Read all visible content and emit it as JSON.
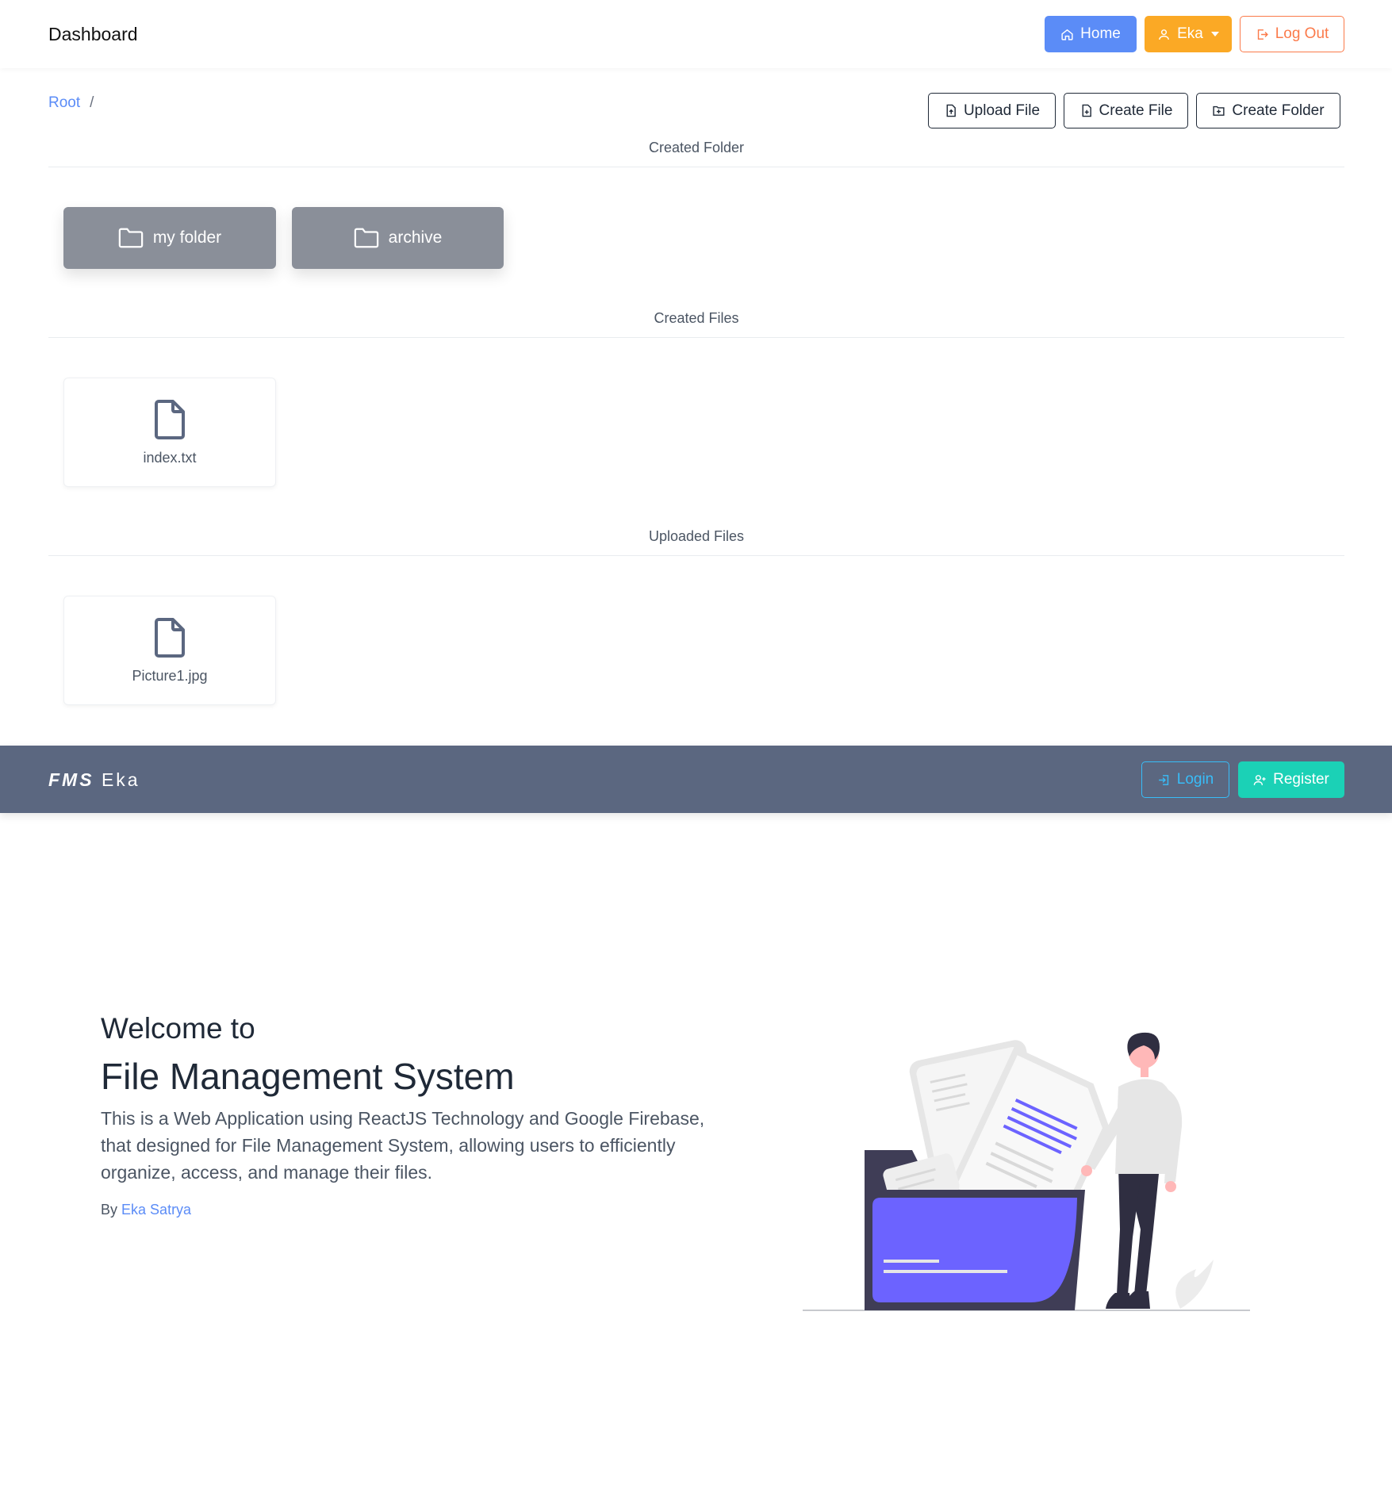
{
  "header": {
    "title": "Dashboard",
    "home_label": "Home",
    "user_label": "Eka",
    "logout_label": "Log Out"
  },
  "breadcrumb": {
    "root": "Root",
    "separator": "/"
  },
  "actions": {
    "upload_file": "Upload File",
    "create_file": "Create File",
    "create_folder": "Create Folder"
  },
  "sections": {
    "created_folder": "Created Folder",
    "created_files": "Created Files",
    "uploaded_files": "Uploaded Files"
  },
  "folders": [
    {
      "name": "my folder"
    },
    {
      "name": "archive"
    }
  ],
  "created_files": [
    {
      "name": "index.txt"
    }
  ],
  "uploaded_files": [
    {
      "name": "Picture1.jpg"
    }
  ],
  "navbar2": {
    "logo_bold": "FMS",
    "logo_name": "Eka",
    "login_label": "Login",
    "register_label": "Register"
  },
  "hero": {
    "welcome": "Welcome to",
    "title": "File Management System",
    "description": "This is a Web Application using ReactJS Technology and Google Firebase, that designed for File Management System, allowing users to efficiently organize, access, and manage their files.",
    "by_label": "By",
    "author": "Eka Satrya"
  },
  "icons": {
    "home": "home-icon",
    "user": "user-icon",
    "logout": "logout-icon",
    "file_upload": "file-upload-icon",
    "file_plus": "file-plus-icon",
    "folder_plus": "folder-plus-icon",
    "folder": "folder-icon",
    "file": "file-icon",
    "login": "login-icon",
    "user_plus": "user-plus-icon"
  },
  "colors": {
    "primary": "#5b8cf7",
    "warning": "#fba925",
    "danger_outline": "#fb7a4a",
    "folder_card": "#8a8f99",
    "navbar2_bg": "#5b6780",
    "info_outline": "#38bdf8",
    "success": "#1bd1b6",
    "illustration_accent": "#6c63ff"
  }
}
